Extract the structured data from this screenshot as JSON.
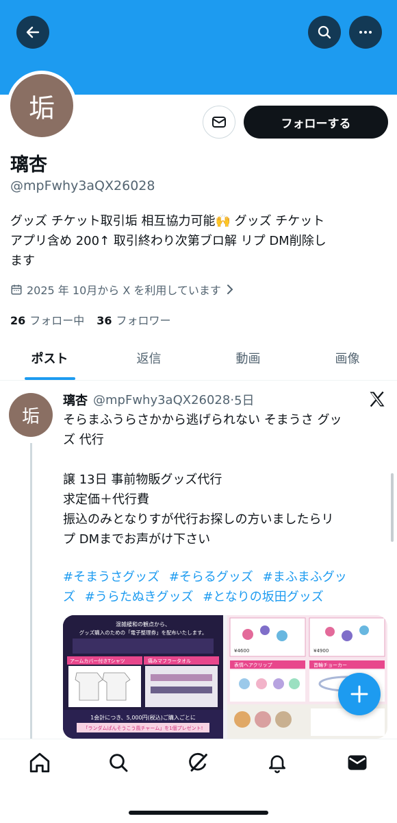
{
  "profile": {
    "avatar_char": "垢",
    "display_name": "璃杏",
    "handle": "@mpFwhy3aQX26028",
    "bio": "グッズ チケット取引垢 相互協力可能🙌 グッズ チケット\nアプリ含め 200↑ 取引終わり次第ブロ解 リプ DM削除し\nます",
    "joined": "2025 年 10月から X を利用しています",
    "following_count": "26",
    "following_label": "フォロー中",
    "followers_count": "36",
    "followers_label": "フォロワー",
    "follow_button": "フォローする"
  },
  "tabs": [
    {
      "label": "ポスト",
      "active": true
    },
    {
      "label": "返信",
      "active": false
    },
    {
      "label": "動画",
      "active": false
    },
    {
      "label": "画像",
      "active": false
    }
  ],
  "post": {
    "avatar_char": "垢",
    "name": "璃杏",
    "handle": "@mpFwhy3aQX26028",
    "separator": "·",
    "time": "5日",
    "text": "そらまふうらさかから逃げられない そまうさ グッ\nズ 代行\n\n譲 13日 事前物販グッズ代行\n求定価＋代行費\n振込のみとなりすが代行お探しの方いましたらリ\nプ DMまでお声がけ下さい",
    "hashtags": [
      "#そまうさグッズ",
      "#そらるグッズ",
      "#まふまふグッ",
      "ズ",
      "#うらたぬきグッズ",
      "#となりの坂田グッズ"
    ],
    "media_text": {
      "line1": "混雑緩和の観点から、",
      "line2": "グッズ購入のための「電子整理券」を配布いたします。",
      "label_a": "アームカバー付きTシャツ",
      "label_b": "痛みマフラータオル",
      "promo": "1会計につき、5,000円(税込)ご購入ごとに",
      "promo2": "「ランダムぱんそうこう風チャーム」を1個プレゼント!",
      "price_a": "¥4600",
      "price_b": "¥4900",
      "label_c": "表情ヘアクリップ",
      "label_d": "首輪チョーカー"
    }
  },
  "colors": {
    "accent": "#1d9bf0",
    "text": "#0f1419",
    "muted": "#536471"
  },
  "icons": {
    "back": "arrow-left-icon",
    "search": "search-icon",
    "more": "more-dots-icon",
    "message": "envelope-icon",
    "calendar": "calendar-icon",
    "chevron": "chevron-right-icon",
    "x_logo": "x-logo-icon",
    "compose": "plus-icon",
    "nav": [
      "home-icon",
      "search-icon",
      "grok-icon",
      "bell-icon",
      "mail-icon"
    ]
  }
}
